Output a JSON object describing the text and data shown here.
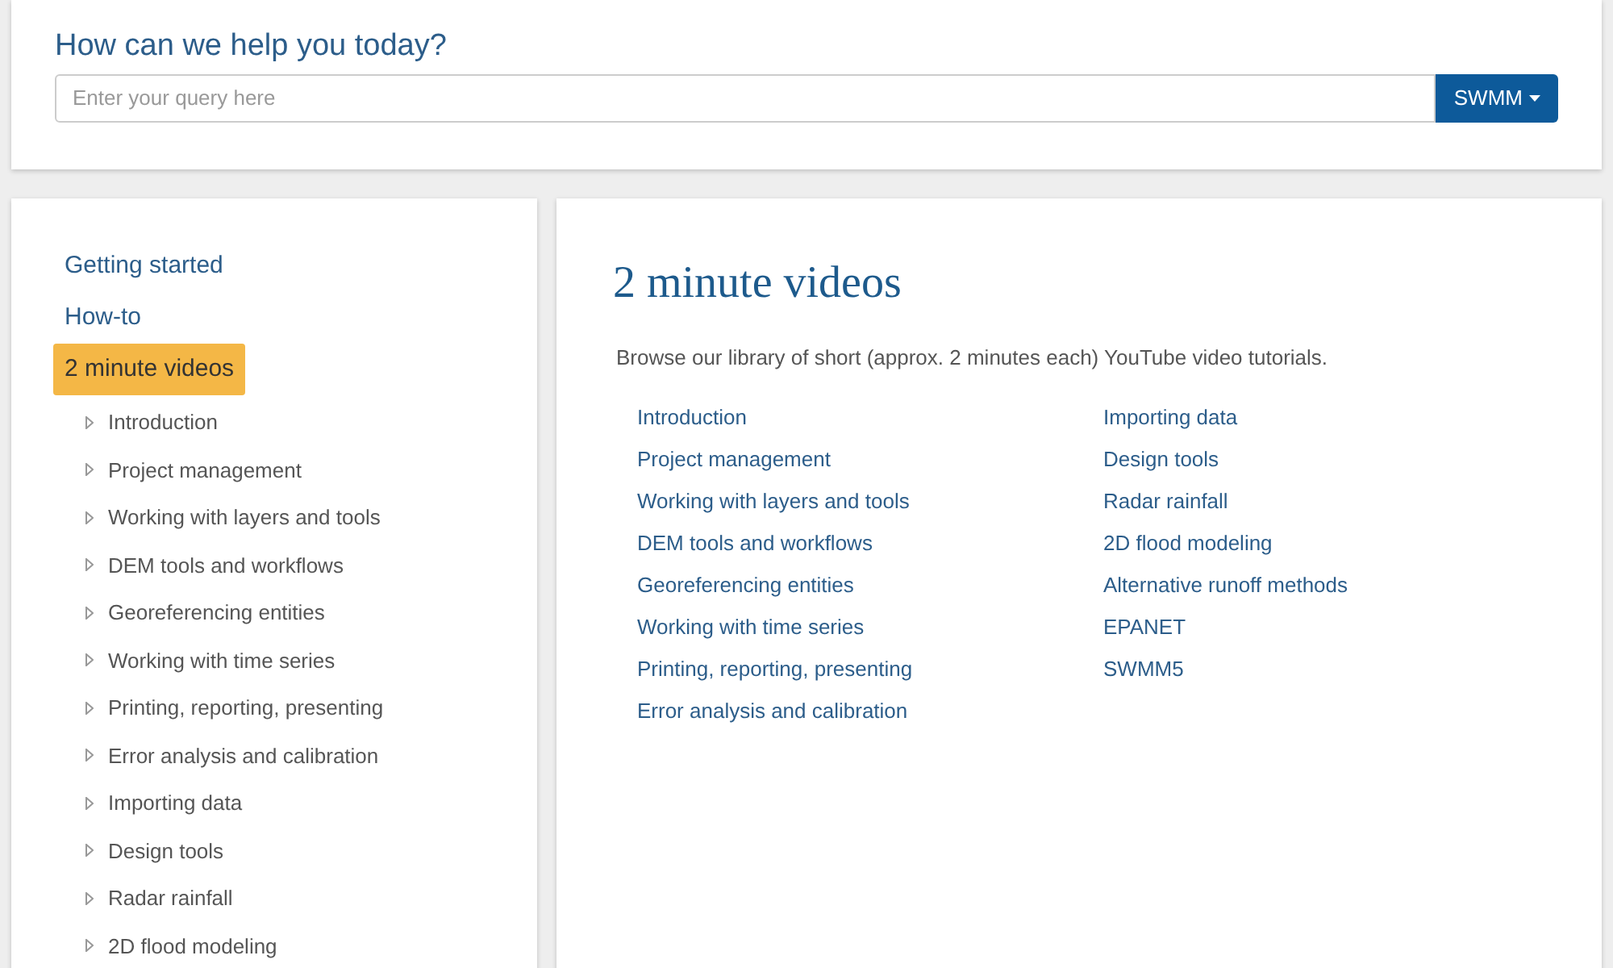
{
  "search": {
    "heading": "How can we help you today?",
    "placeholder": "Enter your query here",
    "scope_button": "SWMM"
  },
  "sidebar": {
    "items": [
      {
        "label": "Getting started",
        "selected": false
      },
      {
        "label": "How-to",
        "selected": false
      },
      {
        "label": "2 minute videos",
        "selected": true,
        "children": [
          {
            "label": "Introduction"
          },
          {
            "label": "Project management"
          },
          {
            "label": "Working with layers and tools"
          },
          {
            "label": "DEM tools and workflows"
          },
          {
            "label": "Georeferencing entities"
          },
          {
            "label": "Working with time series"
          },
          {
            "label": "Printing, reporting, presenting"
          },
          {
            "label": "Error analysis and calibration"
          },
          {
            "label": "Importing data"
          },
          {
            "label": "Design tools"
          },
          {
            "label": "Radar rainfall"
          },
          {
            "label": "2D flood modeling"
          }
        ]
      }
    ]
  },
  "content": {
    "title": "2 minute videos",
    "intro": "Browse our library of short (approx. 2 minutes each) YouTube video tutorials.",
    "links_column_1": [
      "Introduction",
      "Project management",
      "Working with layers and tools",
      "DEM tools and workflows",
      "Georeferencing entities",
      "Working with time series",
      "Printing, reporting, presenting",
      "Error analysis and calibration"
    ],
    "links_column_2": [
      "Importing data",
      "Design tools",
      "Radar rainfall",
      "2D flood modeling",
      "Alternative runoff methods",
      "EPANET",
      "SWMM5"
    ]
  }
}
